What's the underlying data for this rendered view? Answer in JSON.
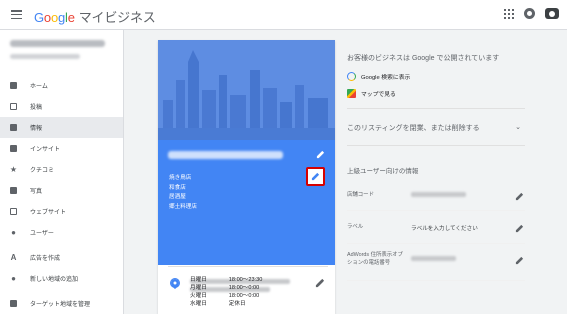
{
  "header": {
    "logo": {
      "G": "G",
      "o1": "o",
      "o2": "o",
      "g": "g",
      "l": "l",
      "e": "e"
    },
    "product": "マイビジネス"
  },
  "sidebar": {
    "items": [
      {
        "label": "ホーム",
        "icon": "home-icon"
      },
      {
        "label": "投稿",
        "icon": "posts-icon"
      },
      {
        "label": "情報",
        "icon": "storefront-icon",
        "active": true
      },
      {
        "label": "インサイト",
        "icon": "insights-icon"
      },
      {
        "label": "クチコミ",
        "icon": "star-icon"
      },
      {
        "label": "写真",
        "icon": "photo-icon"
      },
      {
        "label": "ウェブサイト",
        "icon": "website-icon"
      },
      {
        "label": "ユーザー",
        "icon": "users-icon"
      },
      {
        "label": "広告を作成",
        "icon": "ads-icon"
      },
      {
        "label": "新しい地域の追加",
        "icon": "location-add-icon"
      },
      {
        "label": "ターゲット地域を管理",
        "icon": "manage-locations-icon"
      }
    ]
  },
  "listing": {
    "categories": [
      "焼き鳥店",
      "和食店",
      "居酒屋",
      "郷土料理店"
    ],
    "hours": [
      {
        "day": "日曜日",
        "time": "18:00～23:30"
      },
      {
        "day": "月曜日",
        "time": "18:00～0:00"
      },
      {
        "day": "火曜日",
        "time": "18:00～0:00"
      },
      {
        "day": "水曜日",
        "time": "定休日"
      }
    ]
  },
  "public_panel": {
    "title": "お客様のビジネスは Google で公開されています",
    "search_link": "Google 検索に表示",
    "maps_link": "マップで見る",
    "close_listing": "このリスティングを閉業、または削除する"
  },
  "advanced": {
    "title": "上級ユーザー向けの情報",
    "store_code_label": "店舗コード",
    "label_label": "ラベル",
    "label_value": "ラベルを入力してください",
    "adwords_label": "AdWords 住所表示オプションの電話番号"
  },
  "colors": {
    "accent": "#4285f4",
    "highlight": "#d50000"
  }
}
